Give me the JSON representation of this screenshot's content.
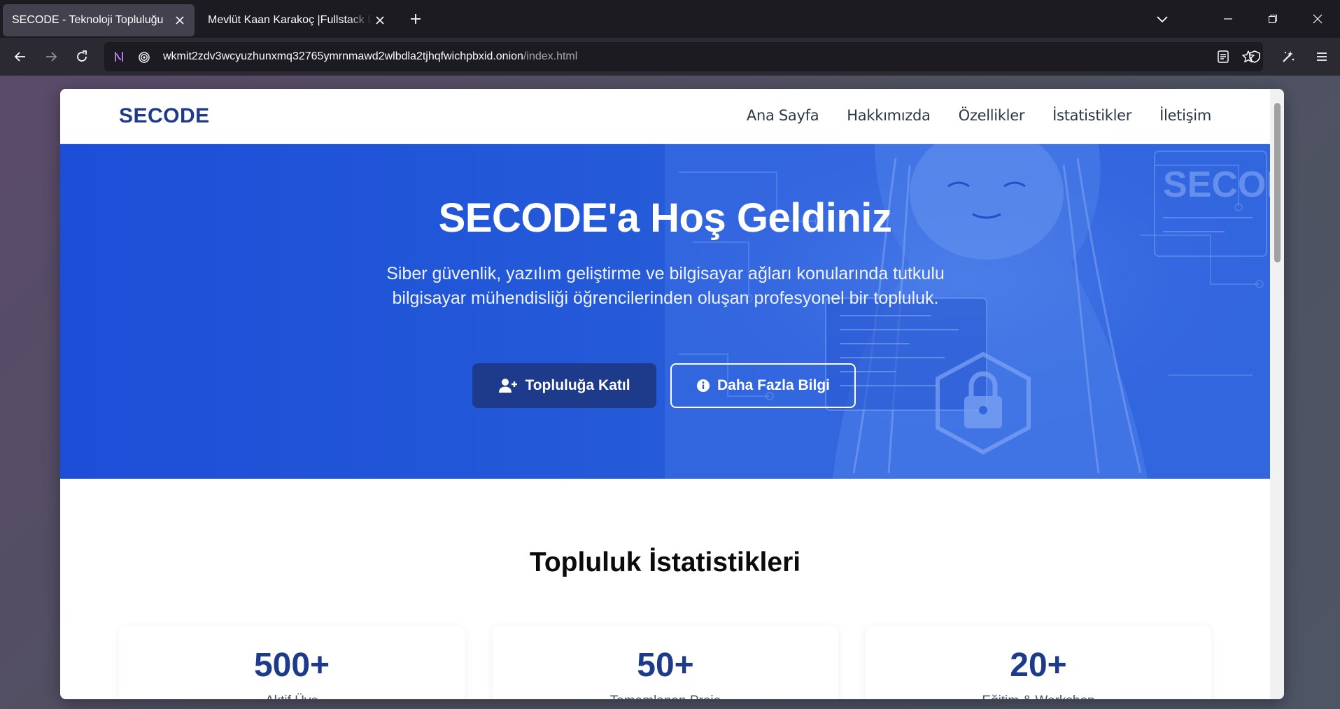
{
  "browser": {
    "tabs": [
      {
        "title": "SECODE - Teknoloji Topluluğu",
        "active": true
      },
      {
        "title": "Mevlüt Kaan Karakoç |Fullstack Developer",
        "active": false
      }
    ],
    "url": {
      "host": "wkmit2zdv3wcyuzhunxmq32765ymrnmawd2wlbdla2tjhqfwichpbxid.onion",
      "path": "/index.html"
    }
  },
  "site": {
    "logo": "SECODE",
    "nav": [
      "Ana Sayfa",
      "Hakkımızda",
      "Özellikler",
      "İstatistikler",
      "İletişim"
    ],
    "hero": {
      "title": "SECODE'a Hoş Geldiniz",
      "subtitle": "Siber güvenlik, yazılım geliştirme ve bilgisayar ağları konularında tutkulu bilgisayar mühendisliği öğrencilerinden oluşan profesyonel bir topluluk.",
      "primary_button": "Topluluğa Katıl",
      "secondary_button": "Daha Fazla Bilgi",
      "art_text": "SECODE"
    },
    "stats": {
      "title": "Topluluk İstatistikleri",
      "items": [
        {
          "value": "500+",
          "label": "Aktif Üye"
        },
        {
          "value": "50+",
          "label": "Tamamlanan Proje"
        },
        {
          "value": "20+",
          "label": "Eğitim & Workshop"
        }
      ]
    }
  },
  "colors": {
    "brand": "#1e3a8a",
    "hero_blue": "#1d4ed8"
  }
}
